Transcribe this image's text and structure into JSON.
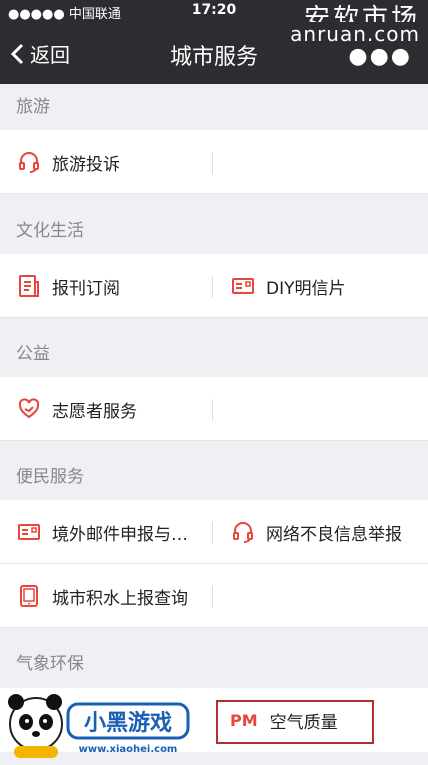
{
  "status_bar": {
    "carrier": "●●●●● 中国联通",
    "time": "17:20",
    "watermark_top": "安软市场"
  },
  "nav": {
    "back_label": "返回",
    "title": "城市服务",
    "watermark_sub": "anruan.com"
  },
  "sections": [
    {
      "title": "旅游",
      "rows": [
        [
          "旅游投诉",
          ""
        ]
      ]
    },
    {
      "title": "文化生活",
      "rows": [
        [
          "报刊订阅",
          "DIY明信片"
        ]
      ]
    },
    {
      "title": "公益",
      "rows": [
        [
          "志愿者服务",
          ""
        ]
      ]
    },
    {
      "title": "便民服务",
      "rows": [
        [
          "境外邮件申报与…",
          "网络不良信息举报"
        ],
        [
          "城市积水上报查询",
          ""
        ]
      ]
    },
    {
      "title": "气象环保",
      "rows": [
        [
          "",
          "空气质量"
        ]
      ]
    }
  ],
  "pm_icon_text": "PM",
  "logo": {
    "text": "小黑游戏",
    "url": "www.xiaohei.com"
  },
  "colors": {
    "accent": "#e8453c",
    "nav_bg": "#2c2d31"
  }
}
